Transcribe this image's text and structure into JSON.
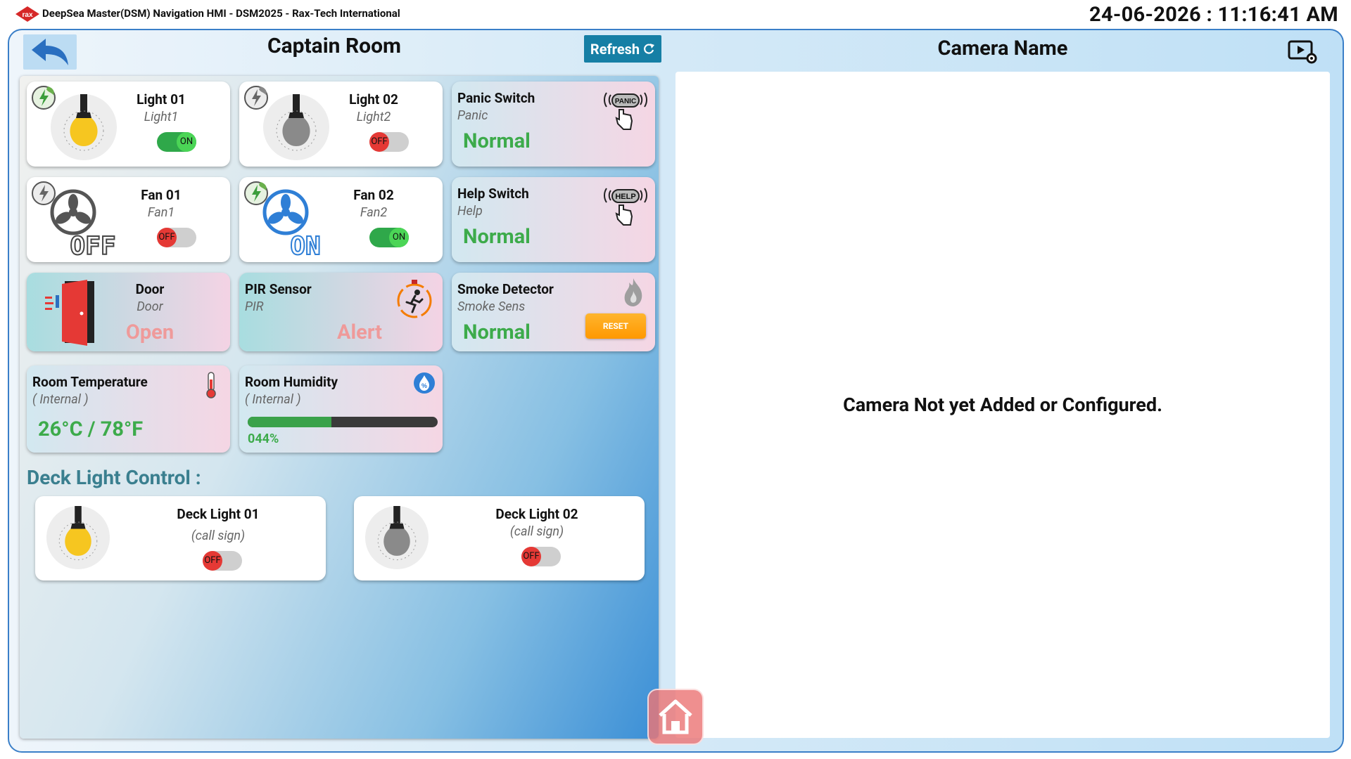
{
  "window": {
    "title": "DeepSea Master(DSM) Navigation HMI - DSM2025 - Rax-Tech International",
    "logo_text": "rax",
    "datetime": "24-06-2026 : 11:16:41 AM"
  },
  "header": {
    "room_title": "Captain Room",
    "refresh_label": "Refresh"
  },
  "devices": {
    "light01": {
      "name": "Light 01",
      "sub": "Light1",
      "toggle": "ON"
    },
    "light02": {
      "name": "Light 02",
      "sub": "Light2",
      "toggle": "OFF"
    },
    "panic": {
      "name": "Panic Switch",
      "sub": "Panic",
      "status": "Normal",
      "icon_text": "PANIC"
    },
    "fan01": {
      "name": "Fan 01",
      "sub": "Fan1",
      "toggle": "OFF",
      "big_label": "OFF"
    },
    "fan02": {
      "name": "Fan 02",
      "sub": "Fan2",
      "toggle": "ON",
      "big_label": "ON"
    },
    "help": {
      "name": "Help Switch",
      "sub": "Help",
      "status": "Normal",
      "icon_text": "HELP"
    },
    "door": {
      "name": "Door",
      "sub": "Door",
      "status": "Open"
    },
    "pir": {
      "name": "PIR Sensor",
      "sub": "PIR",
      "status": "Alert"
    },
    "smoke": {
      "name": "Smoke Detector",
      "sub": "Smoke Sens",
      "status": "Normal",
      "reset_label": "RESET"
    },
    "temperature": {
      "name": "Room Temperature",
      "sub": "( Internal )",
      "value": "26°C / 78°F"
    },
    "humidity": {
      "name": "Room Humidity",
      "sub": "( Internal )",
      "value": "044%",
      "percent": 44
    }
  },
  "deck": {
    "heading": "Deck Light Control :",
    "light01": {
      "name": "Deck Light 01",
      "sub": "(call sign)",
      "toggle": "OFF"
    },
    "light02": {
      "name": "Deck Light 02",
      "sub": "(call sign)",
      "toggle": "OFF"
    }
  },
  "camera": {
    "title": "Camera Name",
    "message": "Camera Not yet Added or Configured."
  },
  "colors": {
    "accent": "#167fa5",
    "status_normal": "#3dab4b",
    "status_alarm_faded": "#ef9a9a",
    "toggle_on": "#2fa84a",
    "toggle_off_knob": "#e53935",
    "frame_border": "#3a7fc8"
  },
  "icons": [
    "rax-logo",
    "back-arrow-icon",
    "refresh-icon",
    "bulb-icon",
    "eco-power-icon",
    "panic-button-icon",
    "help-button-icon",
    "fan-icon",
    "door-icon",
    "pir-runner-icon",
    "flame-icon",
    "thermometer-icon",
    "humidity-icon",
    "camera-settings-icon",
    "home-icon"
  ]
}
